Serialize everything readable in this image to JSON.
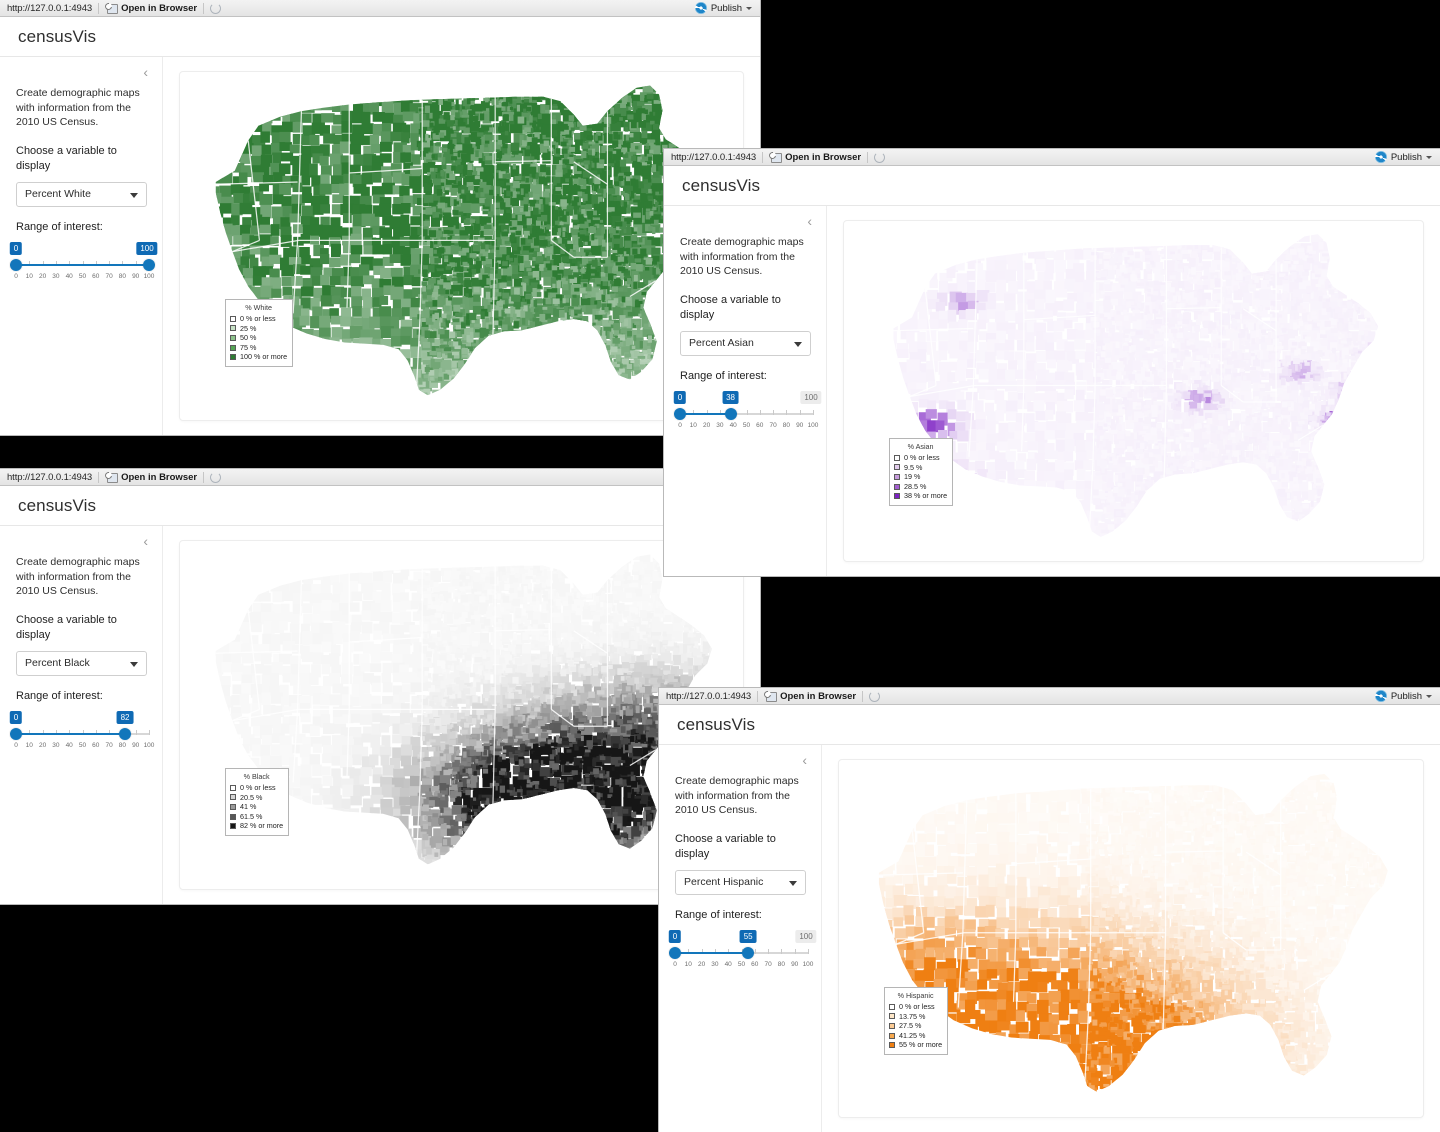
{
  "toolbar": {
    "url": "http://127.0.0.1:4943",
    "open_in_browser": "Open in Browser",
    "publish": "Publish",
    "browser_icon": "open-in-browser-icon",
    "refresh_icon": "refresh-icon",
    "publish_icon": "publish-icon",
    "caret_icon": "chevron-down-icon"
  },
  "app": {
    "title": "censusVis",
    "description": "Create demographic maps with information from the 2010 US Census.",
    "variable_label": "Choose a variable to display",
    "range_label": "Range of interest:",
    "collapse_icon": "chevron-left-icon",
    "scale_ticks": [
      0,
      10,
      20,
      30,
      40,
      50,
      60,
      70,
      80,
      90,
      100
    ],
    "variable_options": [
      "Percent White",
      "Percent Black",
      "Percent Hispanic",
      "Percent Asian"
    ]
  },
  "windows": [
    {
      "id": "window-white",
      "variable": "Percent White",
      "slider": {
        "min": 0,
        "max": 100,
        "low": 0,
        "high": 100,
        "high_muted": false
      },
      "legend": {
        "title": "% White",
        "accent": "#2f7c34",
        "items": [
          {
            "label": "0 % or less",
            "color": "#ffffff"
          },
          {
            "label": "25 %",
            "color": "#c6e0c5"
          },
          {
            "label": "50 %",
            "color": "#8dc28c"
          },
          {
            "label": "75 %",
            "color": "#55a455"
          },
          {
            "label": "100 % or more",
            "color": "#2f7c34"
          }
        ]
      },
      "map": {
        "hue": "green",
        "base": "#2f7c34",
        "pattern": "west-dark-southeast-light"
      }
    },
    {
      "id": "window-asian",
      "variable": "Percent Asian",
      "slider": {
        "min": 0,
        "max": 100,
        "low": 0,
        "high": 38,
        "high_muted": true,
        "muted_label": 100
      },
      "legend": {
        "title": "% Asian",
        "accent": "#8a2be2",
        "items": [
          {
            "label": "0 % or less",
            "color": "#ffffff"
          },
          {
            "label": "9.5 %",
            "color": "#e3cdee"
          },
          {
            "label": "19 %",
            "color": "#c79cdd"
          },
          {
            "label": "28.5 %",
            "color": "#a45fd0"
          },
          {
            "label": "38 % or more",
            "color": "#7d22c3"
          }
        ]
      },
      "map": {
        "hue": "purple",
        "base": "#7d22c3",
        "pattern": "coastal-hotspots"
      }
    },
    {
      "id": "window-black",
      "variable": "Percent Black",
      "slider": {
        "min": 0,
        "max": 100,
        "low": 0,
        "high": 82,
        "high_muted": false
      },
      "legend": {
        "title": "% Black",
        "accent": "#1a1a1a",
        "items": [
          {
            "label": "0 % or less",
            "color": "#ffffff"
          },
          {
            "label": "20.5 %",
            "color": "#d4d4d4"
          },
          {
            "label": "41 %",
            "color": "#9a9a9a"
          },
          {
            "label": "61.5 %",
            "color": "#575757"
          },
          {
            "label": "82 % or more",
            "color": "#161616"
          }
        ]
      },
      "map": {
        "hue": "gray",
        "base": "#161616",
        "pattern": "southeast-dark"
      }
    },
    {
      "id": "window-hispanic",
      "variable": "Percent Hispanic",
      "slider": {
        "min": 0,
        "max": 100,
        "low": 0,
        "high": 55,
        "high_muted": true,
        "muted_label": 100
      },
      "legend": {
        "title": "% Hispanic",
        "accent": "#f07f12",
        "items": [
          {
            "label": "0 % or less",
            "color": "#ffffff"
          },
          {
            "label": "13.75 %",
            "color": "#fde6c8"
          },
          {
            "label": "27.5 %",
            "color": "#fbcb95"
          },
          {
            "label": "41.25 %",
            "color": "#f7a94f"
          },
          {
            "label": "55 % or more",
            "color": "#ef7f12"
          }
        ]
      },
      "map": {
        "hue": "orange",
        "base": "#ef7f12",
        "pattern": "southwest-dark"
      }
    }
  ]
}
